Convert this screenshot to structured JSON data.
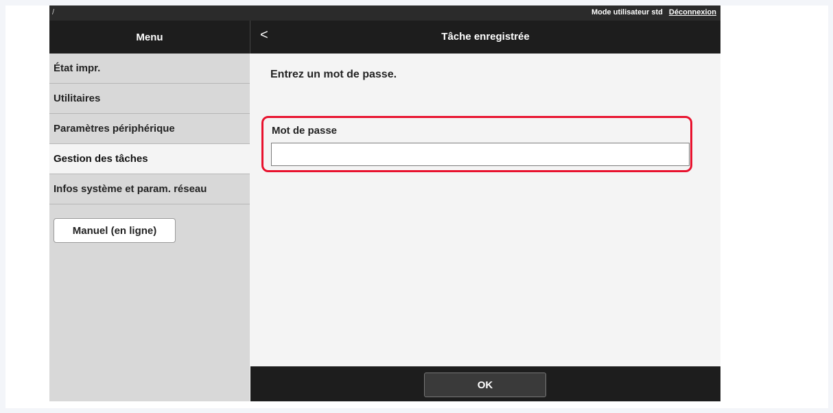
{
  "topbar": {
    "slash": "/",
    "mode": "Mode utilisateur std",
    "logout": "Déconnexion"
  },
  "menu_header": "Menu",
  "content_header": {
    "back_icon": "<",
    "title": "Tâche enregistrée"
  },
  "sidebar": {
    "items": [
      {
        "label": "État impr.",
        "active": false
      },
      {
        "label": "Utilitaires",
        "active": false
      },
      {
        "label": "Paramètres périphérique",
        "active": false
      },
      {
        "label": "Gestion des tâches",
        "active": true
      },
      {
        "label": "Infos système et param. réseau",
        "active": false
      }
    ],
    "manual_button": "Manuel (en ligne)"
  },
  "main": {
    "instruction": "Entrez un mot de passe.",
    "password": {
      "label": "Mot de passe",
      "value": "",
      "placeholder": ""
    }
  },
  "footer": {
    "ok_button": "OK"
  },
  "colors": {
    "highlight_border": "#e8112d",
    "header_bg": "#1d1d1d",
    "sidebar_bg": "#d8d8d8"
  }
}
